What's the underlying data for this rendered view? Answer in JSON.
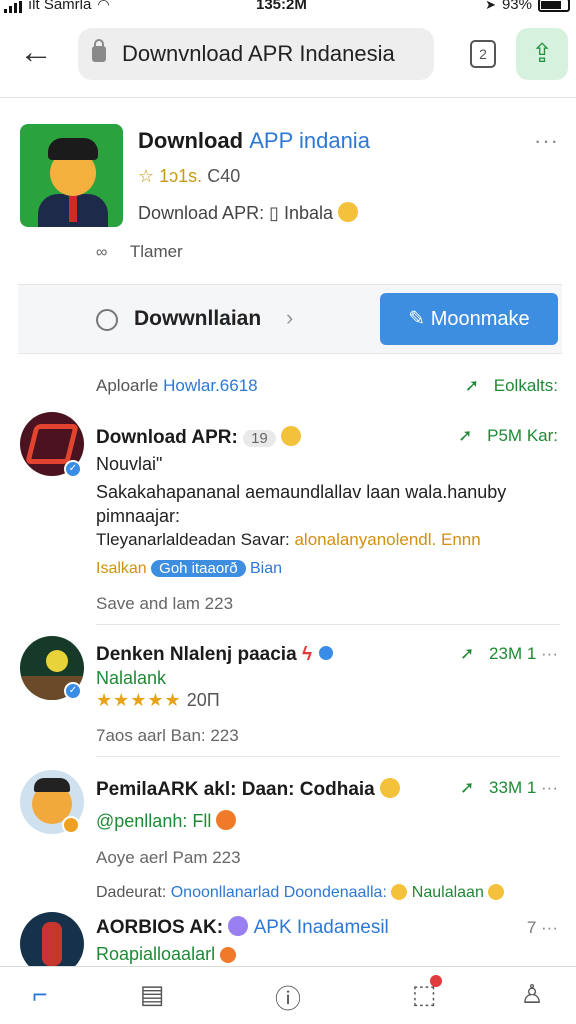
{
  "status_bar": {
    "carrier": "ılt Samrla",
    "time": "135:2M",
    "battery": "93%"
  },
  "top_bar": {
    "search_text": "Downvnload APR Indanesia",
    "tab_label": "2"
  },
  "app": {
    "title_main": "Download",
    "title_accent": "APP indania",
    "rating_text": "1ↄ1s.",
    "rating_count": "C40",
    "subtitle": "Download APR: ▯ Inbala",
    "meta": "Tlamer"
  },
  "action_row": {
    "search_label": "Dowwnllaian",
    "primary_button": "Moonmake"
  },
  "feed_header": {
    "left_text": "Aploarle",
    "left_accent": "Howlar.6618",
    "right_text": "Eolkalts:"
  },
  "posts": [
    {
      "title": "Download APR:",
      "badge": "19",
      "stat": "P5M Kar:",
      "line1": "Nouvlai\"",
      "line2": "Sakakahapananal aemaundlallav laan wala.hanuby",
      "line3": "pimnaajar:",
      "line4_a": "Tleyanarlaldeadan Savar:",
      "line4_b": "alonalanyanolendl.",
      "line4_c": "Ennn",
      "line5_a": "Isalkan",
      "line5_b": "Goh itaaorð",
      "line5_c": "Bian",
      "time": "Save and lam 223"
    },
    {
      "title": "Denken Nlalenj paacia",
      "stat": "23M 1",
      "sub": "Nalalank",
      "rating_count": "20Π",
      "time": "7aos aarl Ban: 223"
    },
    {
      "title": "PemilaARK akl: Daan: Codhaia",
      "stat": "33M 1",
      "sub": "@penllanh: Fll",
      "time": "Aoye aerl Pam 223"
    }
  ],
  "tags_line": {
    "label": "Dadeurat:",
    "value": "Onoonllanarlad Doondenaalla:",
    "tail": "Naulalaan"
  },
  "post4": {
    "title": "AORBIOS AK:",
    "accent": "APK Inadamesil",
    "stat": "7",
    "sub": "Roapialloaalarl"
  },
  "colors": {
    "accent_blue": "#2d78d6",
    "accent_green": "#1e8a35",
    "button_blue": "#3d8ee0"
  },
  "icons": [
    "back-arrow-icon",
    "lock-icon",
    "tabs-icon",
    "share-icon",
    "star-icon",
    "search-icon",
    "chevron-right-icon",
    "pencil-icon",
    "trend-arrow-icon",
    "verified-icon",
    "home-icon",
    "feed-icon",
    "info-icon",
    "notifications-icon",
    "profile-icon"
  ]
}
